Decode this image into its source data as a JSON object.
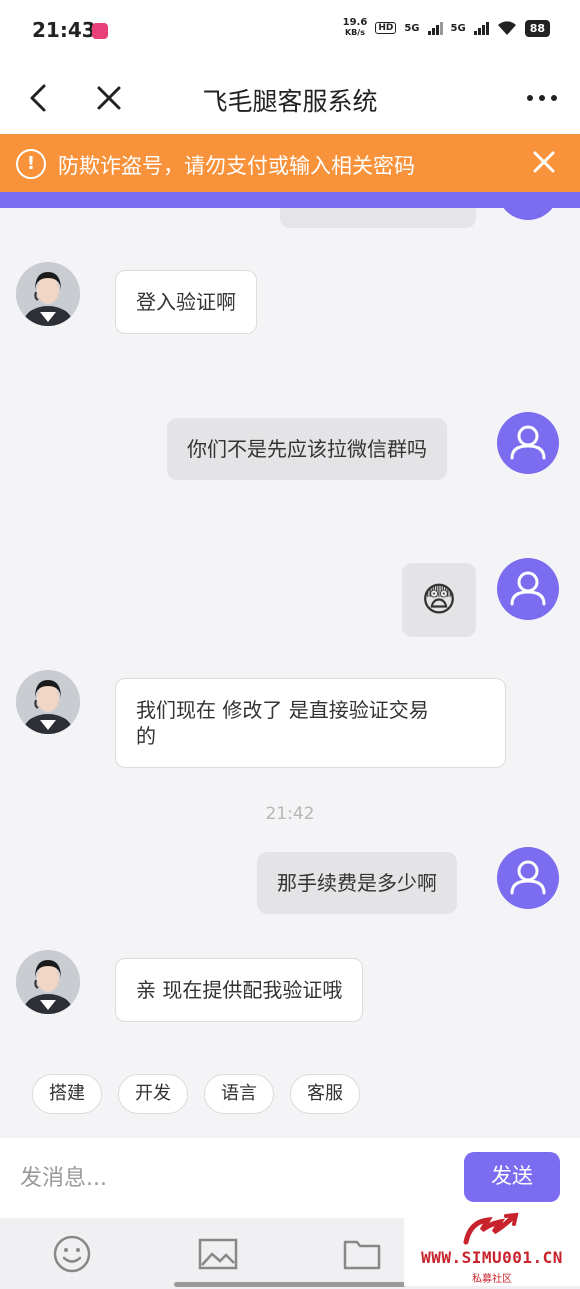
{
  "status_bar": {
    "time": "21:43",
    "net_speed_top": "19.6",
    "net_speed_bottom": "KB/s",
    "hd": "HD",
    "sig1": "5G",
    "sig2": "5G",
    "battery": "88"
  },
  "header": {
    "title": "飞毛腿客服系统"
  },
  "warning": {
    "text": "防欺诈盗号，请勿支付或输入相关密码",
    "icon": "!"
  },
  "messages": [
    {
      "side": "agent",
      "text": "登入验证啊"
    },
    {
      "side": "user",
      "text": "你们不是先应该拉微信群吗"
    },
    {
      "side": "user",
      "text": "😨",
      "type": "emoji"
    },
    {
      "side": "agent",
      "text_line1": "我们现在 修改了 是直接验证交易",
      "text_line2": "的"
    },
    {
      "side": "time",
      "text": "21:42"
    },
    {
      "side": "user",
      "text": "那手续费是多少啊"
    },
    {
      "side": "agent",
      "text": "亲 现在提供配我验证哦"
    }
  ],
  "quick_replies": [
    "搭建",
    "开发",
    "语言",
    "客服"
  ],
  "composer": {
    "placeholder": "发消息...",
    "send_label": "发送"
  },
  "toolbar": {
    "icons": [
      "emoji-icon",
      "image-icon",
      "folder-icon"
    ]
  },
  "watermark": {
    "text": "WWW.SIMU001.CN",
    "sub": "私募社区"
  },
  "colors": {
    "accent": "#7b6cf0",
    "warning": "#f8923b",
    "watermark": "#c8232c"
  }
}
